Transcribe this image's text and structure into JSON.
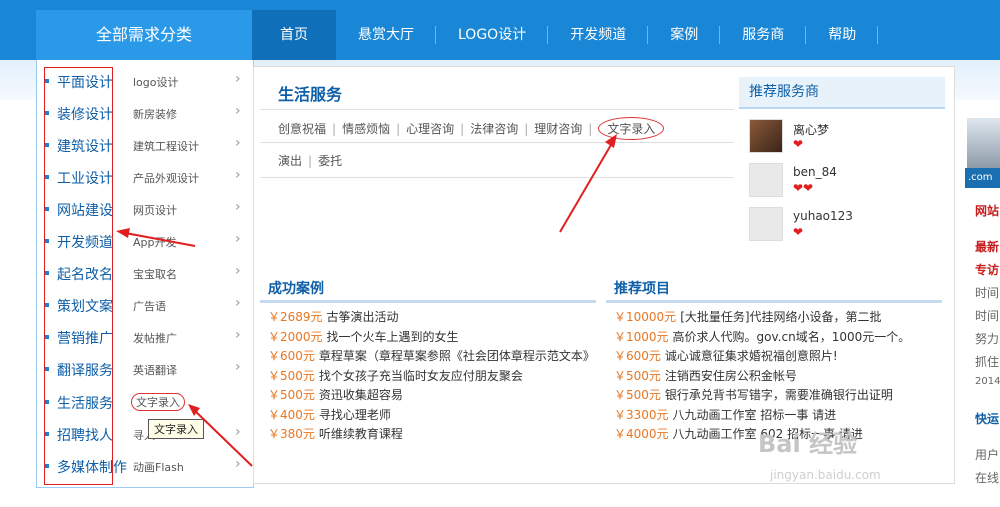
{
  "header": {
    "category_title": "全部需求分类",
    "nav": [
      "首页",
      "悬赏大厅",
      "LOGO设计",
      "开发频道",
      "案例",
      "服务商",
      "帮助"
    ]
  },
  "categories": [
    {
      "main": "平面设计",
      "sub": "logo设计"
    },
    {
      "main": "装修设计",
      "sub": "新房装修"
    },
    {
      "main": "建筑设计",
      "sub": "建筑工程设计"
    },
    {
      "main": "工业设计",
      "sub": "产品外观设计"
    },
    {
      "main": "网站建设",
      "sub": "网页设计"
    },
    {
      "main": "开发频道",
      "sub": "App开发"
    },
    {
      "main": "起名改名",
      "sub": "宝宝取名"
    },
    {
      "main": "策划文案",
      "sub": "广告语"
    },
    {
      "main": "营销推广",
      "sub": "发帖推广"
    },
    {
      "main": "翻译服务",
      "sub": "英语翻译"
    },
    {
      "main": "生活服务",
      "sub": "文字录入"
    },
    {
      "main": "招聘找人",
      "sub": "寻人"
    },
    {
      "main": "多媒体制作",
      "sub": "动画Flash"
    }
  ],
  "tooltip": "文字录入",
  "life_service": {
    "title": "生活服务",
    "links_row1": [
      "创意祝福",
      "情感烦恼",
      "心理咨询",
      "法律咨询",
      "理财咨询",
      "文字录入"
    ],
    "links_row2": [
      "演出",
      "委托"
    ]
  },
  "recommended_providers": {
    "title": "推荐服务商",
    "items": [
      {
        "name": "离心梦",
        "hearts": "❤"
      },
      {
        "name": "ben_84",
        "hearts": "❤❤"
      },
      {
        "name": "yuhao123",
        "hearts": "❤"
      }
    ]
  },
  "success_cases": {
    "title": "成功案例",
    "items": [
      {
        "price": "￥2689元",
        "text": "古筝演出活动"
      },
      {
        "price": "￥2000元",
        "text": "找一个火车上遇到的女生"
      },
      {
        "price": "￥600元",
        "text": "章程草案（章程草案参照《社会团体章程示范文本》"
      },
      {
        "price": "￥500元",
        "text": "找个女孩子充当临时女友应付朋友聚会"
      },
      {
        "price": "￥500元",
        "text": "资迅收集超容易"
      },
      {
        "price": "￥400元",
        "text": "寻找心理老师"
      },
      {
        "price": "￥380元",
        "text": "听维续教育课程"
      }
    ]
  },
  "recommended_projects": {
    "title": "推荐项目",
    "items": [
      {
        "price": "￥10000元",
        "text": "[大批量任务]代挂网络小设备，第二批"
      },
      {
        "price": "￥1000元",
        "text": "高价求人代购。gov.cn域名，1000元一个。"
      },
      {
        "price": "￥600元",
        "text": "诚心诚意征集求婚祝福创意照片!"
      },
      {
        "price": "￥500元",
        "text": "注销西安住房公积金帐号"
      },
      {
        "price": "￥500元",
        "text": "银行承兑背书写错字，需要准确银行出证明"
      },
      {
        "price": "￥3300元",
        "text": "八九动画工作室 招标一事 请进"
      },
      {
        "price": "￥4000元",
        "text": "八九动画工作室 602 招标一事 请进"
      }
    ]
  },
  "right_strip": {
    "tag": ".com",
    "lines": [
      "网站",
      "最新",
      "专访",
      "时间",
      "时间",
      "努力",
      "抓住",
      "2014",
      "快运",
      "用户",
      "在线"
    ]
  },
  "watermark": {
    "text": "Bai 经验",
    "url": "jingyan.baidu.com"
  }
}
